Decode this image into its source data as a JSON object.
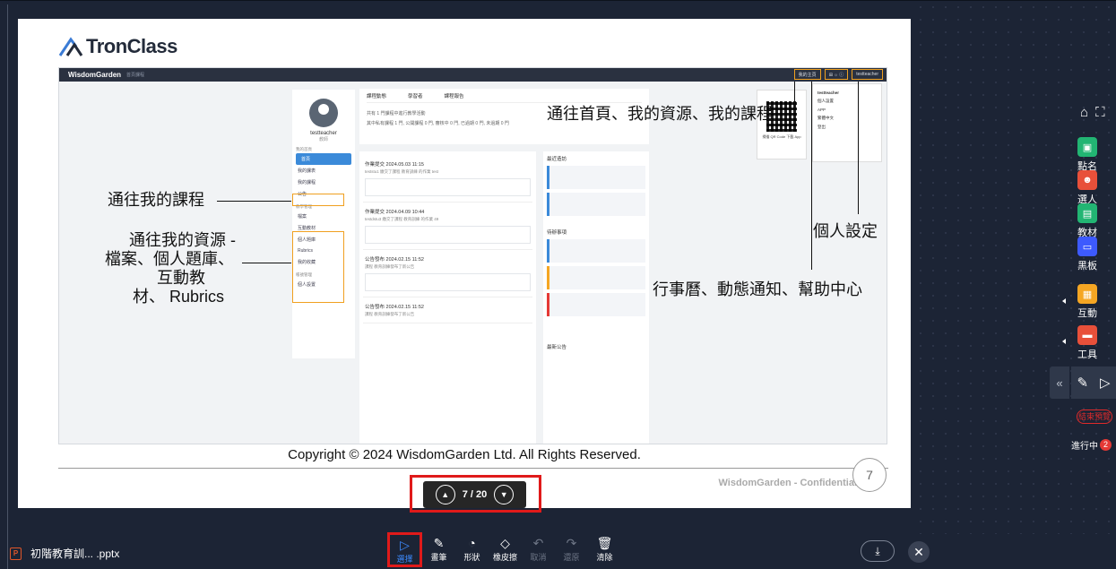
{
  "slide": {
    "logo_text": "TronClass",
    "screenshot": {
      "brand": "WisdomGarden",
      "crumb": "首頁課程",
      "top_right": [
        "我的主頁",
        "⊞ ☼ ⓘ",
        "testteacher"
      ],
      "profile_name": "testteacher",
      "profile_sub": "教師",
      "sections": [
        "我的首頁",
        "教學管理",
        "帳號管理"
      ],
      "side_items": [
        "首頁",
        "我的課表",
        "我的課程",
        "公告",
        "檔案",
        "互動教材",
        "個人題庫",
        "Rubrics",
        "我的收藏",
        "個人設置"
      ],
      "tabs": [
        "課程動態",
        "學習者",
        "課程報告"
      ],
      "summary": "共有 1 門課程中進行教學活動",
      "summary2": "其中私有課程 1 門, 公開課程 0 門, 審核中 0 門, 已過期 0 門, 未過期 0 門",
      "posts": [
        {
          "t": "作業提交 2024.05.03 11:15",
          "s": "teststu1 繳交了課程 教育訓練 的作業 test"
        },
        {
          "t": "作業提交 2024.04.09 10:44",
          "s": "testdstu3 繳交了課程 教育訓練 的作業 49"
        },
        {
          "t": "公告發布 2024.02.15 11:52",
          "s": "課程 教育訓練發布了新公告"
        },
        {
          "t": "公告發布 2024.02.15 11:52",
          "s": "課程 教育訓練發布了新公告"
        }
      ],
      "col3": [
        "最近造訪",
        "待辦事項",
        "最新公告"
      ],
      "qr_caption": "掃描 QR Code 下載 App",
      "user_menu": [
        "testteacher",
        "個人設置",
        "APP",
        "繁體中文",
        "登出"
      ]
    },
    "annotations": {
      "top": "通往首頁、我的資源、我的課程",
      "courses": "通往我的課程",
      "resources": [
        "通往我的資源 -",
        "檔案、個人題庫、",
        "互動教",
        "材、 Rubrics"
      ],
      "personal": "個人設定",
      "calendar": "行事曆、動態通知、幫助中心"
    },
    "copyright": "Copyright © 2024 WisdomGarden Ltd. All Rights Reserved.",
    "confidential": "WisdomGarden - Confidential",
    "page_no": "7"
  },
  "pager": {
    "label": "7 / 20",
    "prev": "▲",
    "next": "▼"
  },
  "right_toolbar": {
    "home_icon": "⌂",
    "expand_icon": "⛶",
    "items": [
      {
        "label": "點名",
        "color": "#22b573",
        "glyph": "▣"
      },
      {
        "label": "選人",
        "color": "#e8503a",
        "glyph": "☻"
      },
      {
        "label": "教材",
        "color": "#22b573",
        "glyph": "▤"
      },
      {
        "label": "黑板",
        "color": "#3d5afe",
        "glyph": "▭"
      },
      {
        "label": "互動",
        "color": "#f5a623",
        "glyph": "▦"
      },
      {
        "label": "工具",
        "color": "#e8503a",
        "glyph": "▬"
      }
    ],
    "collapse": "«",
    "end_preview": "結束預覽",
    "ongoing": "進行中",
    "ongoing_count": "2"
  },
  "bottom": {
    "file_icon": "P",
    "file_name": "初階教育訓...  .pptx",
    "tools": [
      {
        "label": "選擇",
        "glyph": "▷",
        "selected": true
      },
      {
        "label": "畫筆",
        "glyph": "✎"
      },
      {
        "label": "形狀",
        "glyph": "◔"
      },
      {
        "label": "橡皮擦",
        "glyph": "◇"
      },
      {
        "label": "取消",
        "glyph": "↶",
        "dim": true
      },
      {
        "label": "還原",
        "glyph": "↷",
        "dim": true
      },
      {
        "label": "清除",
        "glyph": "🗑"
      }
    ],
    "download_icon": "⤓",
    "close_icon": "✕"
  }
}
